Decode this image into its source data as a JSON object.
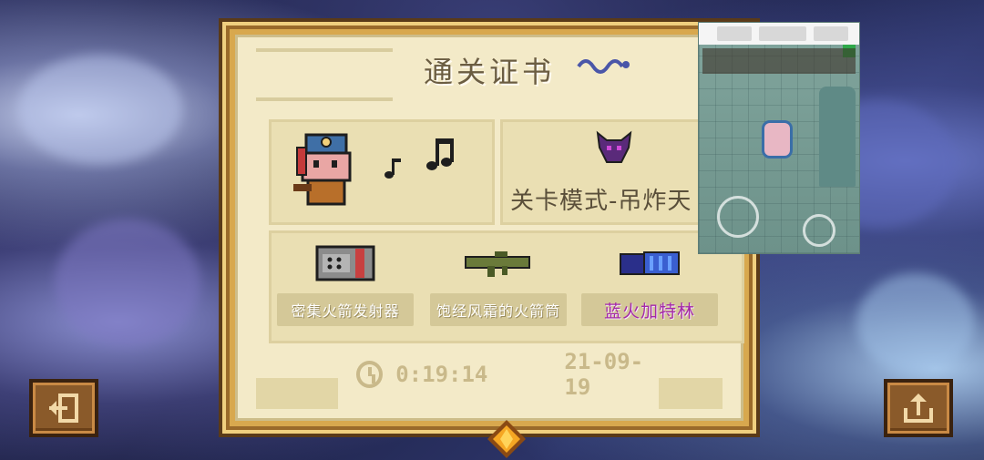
{
  "certificate": {
    "title": "通关证书",
    "level_mode": "关卡模式-吊炸天",
    "weapons": [
      {
        "label": "密集火箭发射器",
        "icon": "rocket-pod-icon"
      },
      {
        "label": "饱经风霜的火箭筒",
        "icon": "bazooka-icon"
      },
      {
        "label": "蓝火加特林",
        "icon": "gatling-icon",
        "highlight_color": "#a42aa8"
      }
    ],
    "time": "0:19:14",
    "date": "21-09-19",
    "character_icon": "knight-character-icon",
    "music_icon": "music-note-icon",
    "level_icon": "demon-skull-icon"
  },
  "buttons": {
    "exit_icon": "exit-icon",
    "share_icon": "share-icon"
  },
  "colors": {
    "frame": "#d8a84e",
    "paper": "#f3eac8",
    "panel": "#eadfb3",
    "accent_purple": "#a42aa8"
  }
}
